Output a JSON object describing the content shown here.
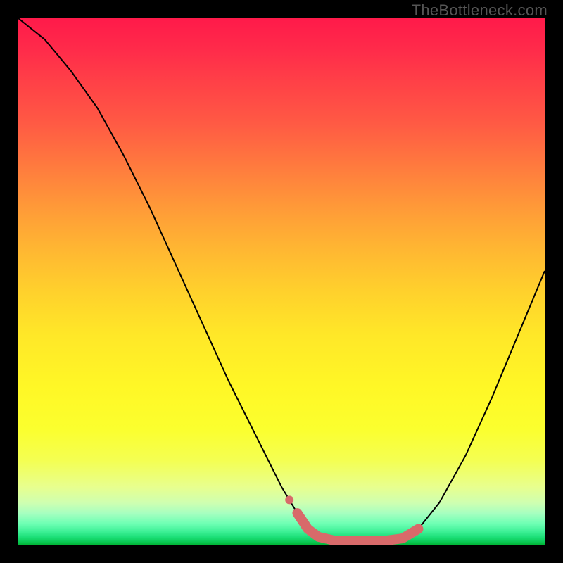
{
  "watermark": "TheBottleneck.com",
  "chart_data": {
    "type": "line",
    "title": "",
    "xlabel": "",
    "ylabel": "",
    "xlim": [
      0,
      100
    ],
    "ylim": [
      0,
      100
    ],
    "grid": false,
    "legend": false,
    "series": [
      {
        "name": "bottleneck-curve",
        "color": "#000000",
        "stroke_width": 2,
        "path": [
          {
            "x": 0,
            "y": 100
          },
          {
            "x": 5,
            "y": 96
          },
          {
            "x": 10,
            "y": 90
          },
          {
            "x": 15,
            "y": 83
          },
          {
            "x": 20,
            "y": 74
          },
          {
            "x": 25,
            "y": 64
          },
          {
            "x": 30,
            "y": 53
          },
          {
            "x": 35,
            "y": 42
          },
          {
            "x": 40,
            "y": 31
          },
          {
            "x": 45,
            "y": 21
          },
          {
            "x": 50,
            "y": 11
          },
          {
            "x": 53,
            "y": 6
          },
          {
            "x": 55,
            "y": 3
          },
          {
            "x": 57,
            "y": 1.5
          },
          {
            "x": 60,
            "y": 0.8
          },
          {
            "x": 65,
            "y": 0.8
          },
          {
            "x": 70,
            "y": 0.8
          },
          {
            "x": 73,
            "y": 1.2
          },
          {
            "x": 76,
            "y": 3
          },
          {
            "x": 80,
            "y": 8
          },
          {
            "x": 85,
            "y": 17
          },
          {
            "x": 90,
            "y": 28
          },
          {
            "x": 95,
            "y": 40
          },
          {
            "x": 100,
            "y": 52
          }
        ]
      },
      {
        "name": "highlight-segment",
        "color": "#d86a6a",
        "stroke_width": 14,
        "linecap": "round",
        "path": [
          {
            "x": 53,
            "y": 6
          },
          {
            "x": 55,
            "y": 3
          },
          {
            "x": 57,
            "y": 1.5
          },
          {
            "x": 60,
            "y": 0.8
          },
          {
            "x": 65,
            "y": 0.8
          },
          {
            "x": 70,
            "y": 0.8
          },
          {
            "x": 73,
            "y": 1.2
          },
          {
            "x": 76,
            "y": 3
          }
        ]
      }
    ],
    "markers": [
      {
        "name": "marker-a",
        "x": 51.5,
        "y": 8.5,
        "r": 6,
        "color": "#d86a6a"
      },
      {
        "name": "marker-b",
        "x": 53.5,
        "y": 5,
        "r": 6,
        "color": "#d86a6a"
      }
    ]
  }
}
